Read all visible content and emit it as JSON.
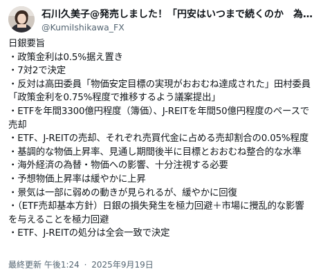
{
  "post": {
    "author": {
      "display_name": "石川久美子@発売しました！「円安はいつまで続くのか　為替で世…",
      "handle": "@KumiIshikawa_FX"
    },
    "lines": [
      "日銀要旨",
      "・政策金利は0.5%据え置き",
      "・7対2で決定",
      "・反対は高田委員「物価安定目標の実現がおおむね達成された」田村委員",
      "「政策金利を0.75%程度で推移するよう議案提出」",
      "・ETFを年間3300億円程度（簿価）、J-REITを年間50億円程度のペースで",
      "売却",
      "・ETF、J-REITの売却、それぞれ売買代金に占める売却割合の0.05%程度",
      "・基調的な物価上昇率、見通し期間後半に目標とおおむね整合的な水準",
      "・海外経済の為替・物価への影響、十分注視する必要",
      "・予想物価上昇率は緩やかに上昇",
      "・景気は一部に弱めの動きが見られるが、緩やかに回復",
      "・（ETF売却基本方針）日銀の損失発生を極力回避＋市場に攪乱的な影響",
      "を与えることを極力回避",
      "・ETF、J-REITの処分は全会一致で決定"
    ],
    "footer": {
      "label": "最終更新",
      "time": "午後1:24",
      "separator": "·",
      "date": "2025年9月19日"
    }
  },
  "colors": {
    "text": "#0f1419",
    "secondary": "#536471",
    "background": "#ffffff"
  },
  "icons": {
    "avatar": "profile-photo"
  }
}
